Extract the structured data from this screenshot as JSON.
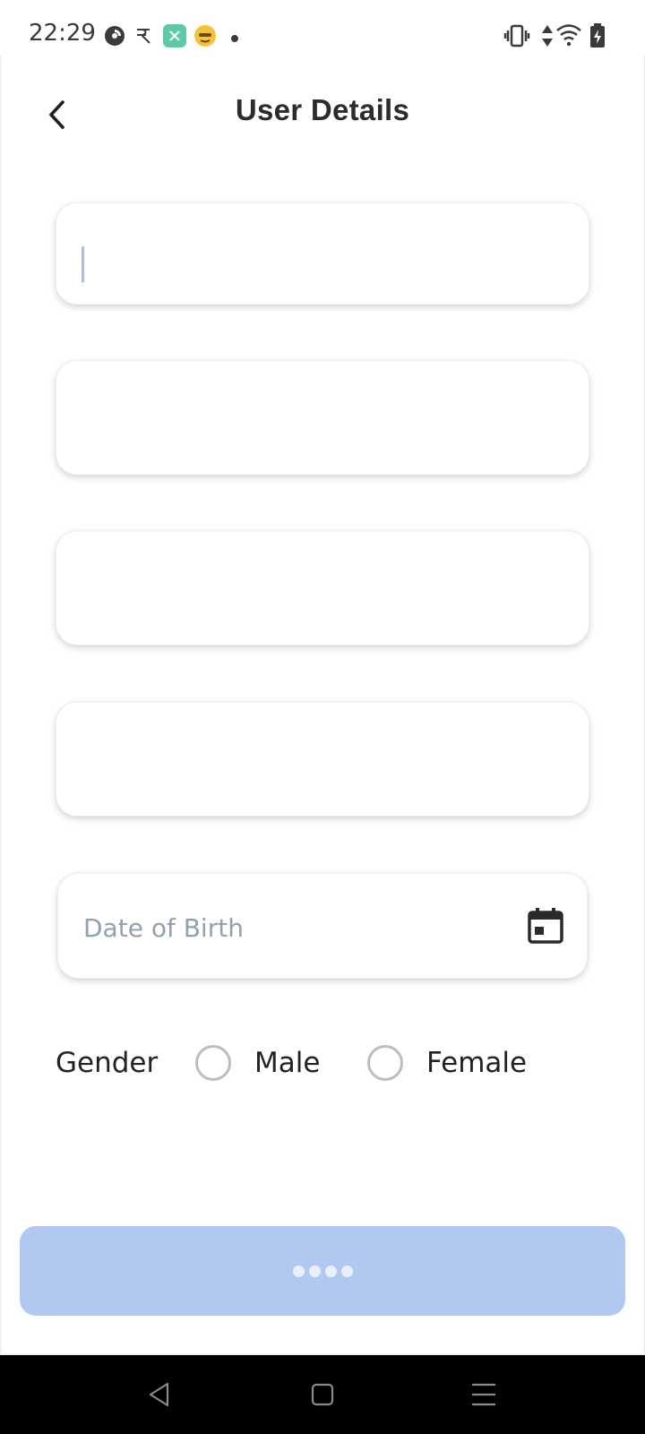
{
  "status_bar": {
    "time": "22:29",
    "icons": [
      "pocket-casts-icon",
      "rupee-app-icon",
      "green-app-icon",
      "emoji-app-icon",
      "notification-dot-icon"
    ],
    "right_icons": [
      "vibrate-icon",
      "data-arrows-icon",
      "wifi-icon",
      "battery-charging-icon"
    ]
  },
  "header": {
    "title": "User Details",
    "back_icon": "chevron-left-icon"
  },
  "form": {
    "field1": {
      "value": "",
      "placeholder": ""
    },
    "field2": {
      "value": "",
      "placeholder": ""
    },
    "field3": {
      "value": "",
      "placeholder": ""
    },
    "field4": {
      "value": "",
      "placeholder": ""
    },
    "dob": {
      "placeholder": "Date of Birth",
      "icon": "calendar-icon"
    },
    "gender": {
      "label": "Gender",
      "options": [
        {
          "label": "Male",
          "selected": false
        },
        {
          "label": "Female",
          "selected": false
        }
      ]
    },
    "submit": {
      "state": "loading",
      "color": "#b1c8f0"
    }
  },
  "colors": {
    "accent": "#b1c8f0",
    "caret": "#a8c0ee",
    "placeholder": "#93a0ad",
    "nav_bar": "#000000"
  },
  "nav_bar": {
    "buttons": [
      "back-triangle-icon",
      "home-square-icon",
      "recents-menu-icon"
    ]
  }
}
